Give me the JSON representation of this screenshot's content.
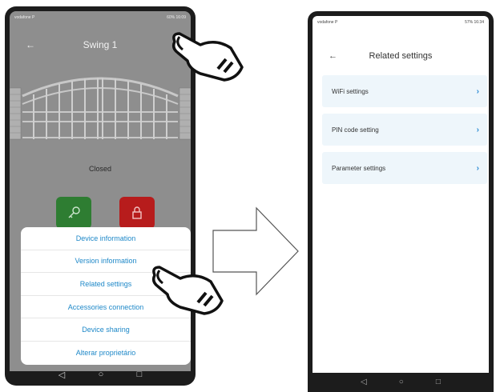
{
  "left_screen": {
    "status": {
      "left": "vodafone P",
      "right": "60% 16:09"
    },
    "title": "Swing 1",
    "back_icon": "arrow-left-icon",
    "more_icon": "more-vert-icon",
    "gate_status": "Closed",
    "menu": [
      {
        "label": "Device information"
      },
      {
        "label": "Version information"
      },
      {
        "label": "Related settings"
      },
      {
        "label": "Accessories connection"
      },
      {
        "label": "Device sharing"
      },
      {
        "label": "Alterar proprietário"
      }
    ],
    "colors": {
      "open_button": "#2e7d32",
      "lock_button": "#b71c1c",
      "menu_text": "#1e88c8"
    }
  },
  "right_screen": {
    "status": {
      "left": "vodafone P",
      "right": "57% 16:34"
    },
    "title": "Related settings",
    "items": [
      {
        "label": "WiFi settings"
      },
      {
        "label": "PIN code setting"
      },
      {
        "label": "Parameter settings"
      }
    ],
    "colors": {
      "item_bg": "#eef6fb",
      "chevron": "#2a8bd4"
    }
  },
  "nav_icons": [
    "back-triangle-icon",
    "home-circle-icon",
    "recents-square-icon"
  ]
}
